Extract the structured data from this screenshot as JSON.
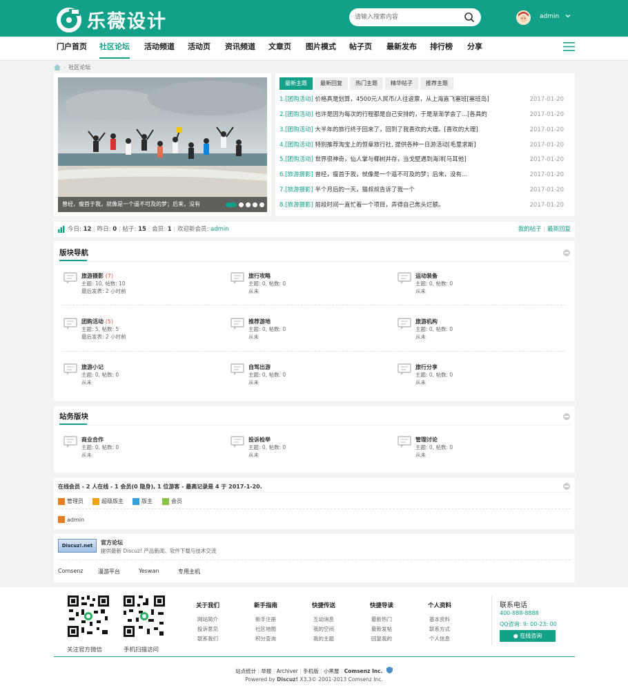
{
  "header": {
    "logo_text": "乐薇设计",
    "search_placeholder": "请输入搜索内容",
    "user_name": "admin"
  },
  "nav": {
    "items": [
      "门户首页",
      "社区论坛",
      "活动频道",
      "活动页",
      "资讯频道",
      "文章页",
      "图片模式",
      "帖子页",
      "最新发布",
      "排行榜",
      "分享"
    ],
    "active": "社区论坛"
  },
  "breadcrumb": {
    "current": "社区论坛"
  },
  "slider": {
    "caption": "曾经，瘦首于我，就像是一个遥不可及的梦；后来，没有",
    "dot_count": 5
  },
  "thread_tabs": [
    "最新主题",
    "最新回复",
    "热门主题",
    "精华帖子",
    "推荐主题"
  ],
  "threads": [
    {
      "num": "1",
      "cat": "[团购活动]",
      "title": "价格真是划算，4500元人民币/人往返票，从上海直飞塞班[塞班岛]",
      "date": "2017-01-20"
    },
    {
      "num": "2",
      "cat": "[团购活动]",
      "title": "也许是因为每次的行程都是自己安排的，于是渐渐学会了...[各具的",
      "date": "2017-01-20"
    },
    {
      "num": "3",
      "cat": "[团购活动]",
      "title": "大半年的旅行终于回来了，回到了我喜欢的大理。[喜欢的大理]",
      "date": "2017-01-20"
    },
    {
      "num": "4",
      "cat": "[团购活动]",
      "title": "特别推荐淘宝上的恒章旅行社, 提供各种一日游活动[毛里求斯]",
      "date": "2017-01-20"
    },
    {
      "num": "5",
      "cat": "[团购活动]",
      "title": "世界很神奇，仙人掌与椰树并存，当戈壁遇到海洋[马耳他]",
      "date": "2017-01-20"
    },
    {
      "num": "6",
      "cat": "[旅游摄影]",
      "title": "曾经，瘦首于我，就像是一个遥不可及的梦；后来，没有...",
      "date": "2017-01-20"
    },
    {
      "num": "7",
      "cat": "[旅游摄影]",
      "title": "半个月后的一天，猫叔叔告诉了我一个",
      "date": "2017-01-20"
    },
    {
      "num": "8",
      "cat": "[旅游摄影]",
      "title": "前段时间一直忙着一个项目，弄得自己焦头烂额。",
      "date": "2017-01-20"
    }
  ],
  "stats": {
    "today_label": "今日:",
    "today": "12",
    "yesterday_label": "昨日:",
    "yesterday": "0",
    "posts_label": "帖子:",
    "posts": "15",
    "members_label": "会员:",
    "members": "1",
    "welcome_label": "欢迎新会员:",
    "new_member": "admin",
    "my_posts": "我的帖子",
    "latest_replies": "最新回复"
  },
  "forum_nav": {
    "title": "版块导航",
    "forums": [
      {
        "name": "旅游摄影",
        "new": "(7)",
        "line2": "主题: 10, 帖数: 10",
        "line3": "最后发表: 2 小时前"
      },
      {
        "name": "旅行攻略",
        "new": "",
        "line2": "主题: 0, 帖数: 0",
        "line3": "从未"
      },
      {
        "name": "运动装备",
        "new": "",
        "line2": "主题: 0, 帖数: 0",
        "line3": "从未"
      },
      {
        "name": "团购活动",
        "new": "(5)",
        "line2": "主题: 5, 帖数: 5",
        "line3": "最后发表: 2 小时前"
      },
      {
        "name": "推荐游地",
        "new": "",
        "line2": "主题: 0, 帖数: 0",
        "line3": "从未"
      },
      {
        "name": "旅游机构",
        "new": "",
        "line2": "主题: 0, 帖数: 0",
        "line3": "从未"
      },
      {
        "name": "旅游小记",
        "new": "",
        "line2": "主题: 0, 帖数: 0",
        "line3": "从未"
      },
      {
        "name": "自驾出游",
        "new": "",
        "line2": "主题: 0, 帖数: 0",
        "line3": "从未"
      },
      {
        "name": "旅行分享",
        "new": "",
        "line2": "主题: 0, 帖数: 0",
        "line3": "从未"
      }
    ]
  },
  "station_forums": {
    "title": "站务版块",
    "forums": [
      {
        "name": "商业合作",
        "line2": "主题: 0, 帖数: 0",
        "line3": "从未"
      },
      {
        "name": "投诉检举",
        "line2": "主题: 0, 帖数: 0",
        "line3": "从未"
      },
      {
        "name": "管理讨论",
        "line2": "主题: 0, 帖数: 0",
        "line3": "从未"
      }
    ]
  },
  "online": {
    "summary": "在线会员 - 2 人在线 - 1 会员(0 隐身), 1 位游客 - 最高记录是 4 于 2017-1-20.",
    "legend": [
      "管理员",
      "超级版主",
      "版主",
      "会员"
    ],
    "users": [
      "admin"
    ]
  },
  "links": {
    "banner_text": "Discuz!.net",
    "official_title": "官方论坛",
    "official_desc": "提供最新 Discuz! 产品新闻、软件下载与技术交流",
    "partners": [
      "Comsenz",
      "漫游平台",
      "Yeswan",
      "专用主机"
    ]
  },
  "footer": {
    "qr1_label": "关注官方微信",
    "qr2_label": "手机扫描访问",
    "columns": [
      {
        "title": "关于我们",
        "links": [
          "网站简介",
          "投诉意见",
          "联系我们"
        ]
      },
      {
        "title": "新手指南",
        "links": [
          "新手注册",
          "社区地图",
          "积分查询"
        ]
      },
      {
        "title": "快捷传送",
        "links": [
          "互动消息",
          "我的空间",
          "我的主题"
        ]
      },
      {
        "title": "快捷导读",
        "links": [
          "最新热门",
          "最新发帖",
          "回复我的"
        ]
      },
      {
        "title": "个人资料",
        "links": [
          "基本资料",
          "联系方式",
          "个人信息"
        ]
      }
    ],
    "phone_title": "联系电话",
    "phone": "400-888-8888",
    "qq_hours": "QQ咨询: 9: 00-23: 00",
    "consult": "在线咨询",
    "bottom_links": [
      "站点统计",
      "举报",
      "Archiver",
      "手机版",
      "小黑屋",
      "Comsenz Inc."
    ],
    "powered_prefix": "Powered by",
    "powered_brand": "Discuz!",
    "powered_suffix": "X3.3© 2001-2013 Comsenz Inc."
  },
  "colors": {
    "accent": "#13a089",
    "new_count": "#e74c3c"
  }
}
